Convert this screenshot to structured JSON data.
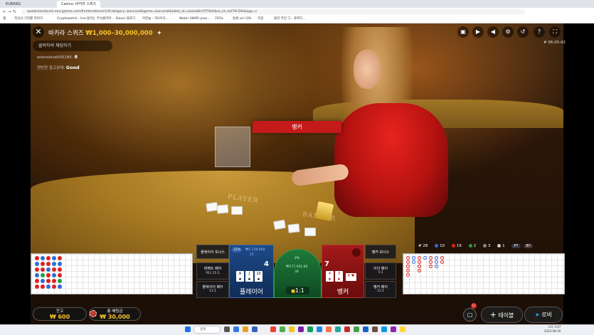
{
  "browser": {
    "tabs": [
      "KUBANG",
      "Casino: 바카라 스퀴즈"
    ],
    "url": "spadeclancbcoin.evo-games.com/frontend/evo/r2/#category=baccarat&game=baccarat&table_id=zixzea8nrf7f7bzh&vt_id=zxf70c5tfs&app=c",
    "bookmarks": [
      "앱",
      "지식사 기자를 북마크",
      "Cryptowatch - live",
      "돌리는 주식콜라마...",
      "Daum 블로그",
      "커뮤늘 - 70(이더...",
      "Water (WAP) proc...",
      "카카노",
      "컵세 url (19)",
      "북장",
      "블라 주민 그 - 로피드..."
    ]
  },
  "game": {
    "close_icon": "close-icon",
    "title": "바카라 스퀴즈",
    "limits": "₩1,000–30,000,000",
    "favorite_icon": "star-icon",
    "chat_prompt": "클릭하여 채팅하기",
    "chat_user": "wtevoleza000185:",
    "chat_user_count": "8",
    "connection_label": "현빈한 접고상태:",
    "connection_value": "Good",
    "clock": "# 06:05:42",
    "top_icons": [
      "chat-icon",
      "video-icon",
      "sound-icon",
      "settings-icon",
      "history-icon",
      "help-icon",
      "fullscreen-icon"
    ],
    "result_banner": "뱅커"
  },
  "stats": {
    "hash": "# 28",
    "player_count": "10",
    "banker_count": "16",
    "tie_count": "2",
    "pairs": "3",
    "other": "1",
    "p_predict": "P?",
    "b_predict": "B?"
  },
  "bets": {
    "player_bonus": "플레이어 보너스",
    "perfect_pair": "퍼펙트 페어",
    "perfect_pair_odds": "어나 25:1",
    "player_pair": "플레이어 페어",
    "player_pair_odds": "11:1",
    "player_pool": "₩1,739,600",
    "player_players": "21",
    "player_pct": "22%",
    "player_total": "4",
    "player_label": "플레이어",
    "tie_pct": "2%",
    "tie_pool": "₩177,082.88",
    "tie_players": "38",
    "tie_odds": "1:1",
    "banker_total": "7",
    "banker_label": "뱅커",
    "banker_bonus": "뱅커 보너스",
    "either_pair": "이더 페어",
    "either_pair_odds": "5:1",
    "banker_pair": "뱅커 페어",
    "banker_pair_odds": "11:1",
    "player_cards": [
      {
        "rank": "A",
        "suit": "♠",
        "red": false
      },
      {
        "rank": "J",
        "suit": "♠",
        "red": false
      },
      {
        "rank": "10",
        "suit": "♠",
        "red": false
      }
    ],
    "banker_cards": [
      {
        "rank": "4",
        "suit": "♦",
        "red": true
      },
      {
        "rank": "3",
        "suit": "♦",
        "red": true
      },
      {
        "rank": "K",
        "suit": "♥",
        "red": true
      }
    ]
  },
  "bottom": {
    "balance_label": "잔고",
    "balance_value": "₩ 600",
    "total_bet_label": "총 베팅금",
    "total_bet_value": "₩ 30,000",
    "chat_badge": "11",
    "table_button": "테이블",
    "lobby_button": "로비"
  },
  "taskbar": {
    "search_label": "검색",
    "time": "오후 3:07",
    "date": "2023-08-16"
  },
  "colors": {
    "gold": "#f6c229",
    "player_blue": "#1d4b8a",
    "banker_red": "#a41a1a",
    "tie_green": "#1f7a3a"
  }
}
